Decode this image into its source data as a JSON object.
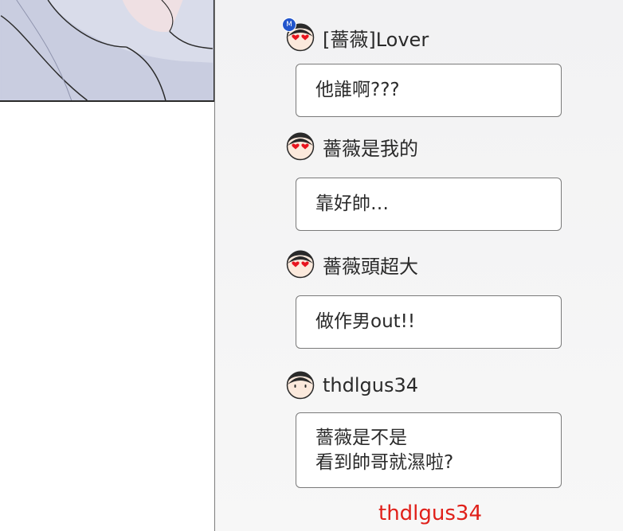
{
  "panel_art": {
    "skin": "#c9cde0",
    "line": "#2a2a2a"
  },
  "comments": [
    {
      "username": "[薔薇]Lover",
      "avatar": "heart-eyes",
      "badge": "M",
      "text": "他誰啊???"
    },
    {
      "username": "薔薇是我的",
      "avatar": "heart-eyes",
      "text": "靠好帥…"
    },
    {
      "username": "薔薇頭超大",
      "avatar": "heart-eyes",
      "text": "做作男out!!"
    },
    {
      "username": "thdlgus34",
      "avatar": "neutral",
      "text": "薔薇是不是\n看到帥哥就濕啦?"
    }
  ],
  "watermark": "thdlgus34",
  "colors": {
    "watermark": "#e0201a",
    "bubble_border": "#7a7a7a",
    "heart": "#e8141e",
    "badge": "#2255cc"
  }
}
